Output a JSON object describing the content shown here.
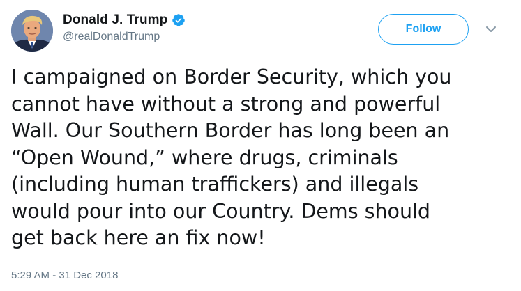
{
  "user": {
    "display_name": "Donald J. Trump",
    "handle": "@realDonaldTrump",
    "verified": true
  },
  "actions": {
    "follow_label": "Follow"
  },
  "tweet": {
    "text": "I campaigned on Border Security, which you\ncannot have without a strong and powerful\nWall. Our Southern Border has long been an\n“Open Wound,” where drugs, criminals\n(including human traffickers) and illegals\nwould pour into our Country. Dems should\nget back here an fix now!",
    "timestamp": "5:29 AM - 31 Dec 2018"
  },
  "colors": {
    "accent": "#1da1f2",
    "text": "#14171a",
    "secondary_text": "#657786"
  },
  "icons": {
    "verified": "verified-badge-icon",
    "more": "chevron-down-icon"
  }
}
